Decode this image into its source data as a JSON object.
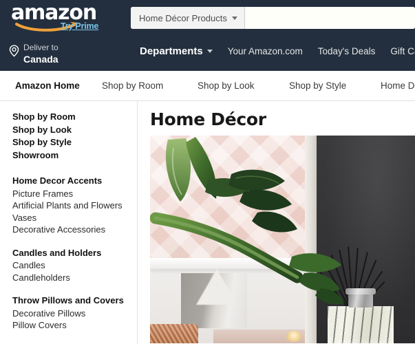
{
  "brand": {
    "logo_text": "amazon",
    "prime_link": "Try Prime"
  },
  "search": {
    "category": "Home Décor Products",
    "placeholder": "",
    "value": ""
  },
  "deliver": {
    "label": "Deliver to",
    "location": "Canada",
    "icon": "location-pin-icon"
  },
  "nav": {
    "departments": "Departments",
    "links": [
      "Your Amazon.com",
      "Today's Deals",
      "Gift Car"
    ]
  },
  "subnav": {
    "items": [
      {
        "label": "Amazon Home",
        "active": true
      },
      {
        "label": "Shop by Room",
        "active": false
      },
      {
        "label": "Shop by Look",
        "active": false
      },
      {
        "label": "Shop by Style",
        "active": false
      },
      {
        "label": "Home De",
        "active": false
      }
    ]
  },
  "sidebar": {
    "groups": [
      {
        "heads": [
          "Shop by Room",
          "Shop by Look",
          "Shop by Style",
          "Showroom"
        ],
        "items": []
      },
      {
        "heads": [
          "Home Decor Accents"
        ],
        "items": [
          "Picture Frames",
          "Artificial Plants and Flowers",
          "Vases",
          "Decorative Accessories"
        ]
      },
      {
        "heads": [
          "Candles and Holders"
        ],
        "items": [
          "Candles",
          "Candleholders"
        ]
      },
      {
        "heads": [
          "Throw Pillows and Covers"
        ],
        "items": [
          "Decorative Pillows",
          "Pillow Covers"
        ]
      }
    ]
  },
  "main": {
    "title": "Home Décor",
    "hero_alt": "home-decor-hero-banner"
  },
  "colors": {
    "header_bg": "#232f3e",
    "prime_blue": "#7bc4e8",
    "logo_orange": "#f0a13c",
    "text_dark": "#111111"
  }
}
